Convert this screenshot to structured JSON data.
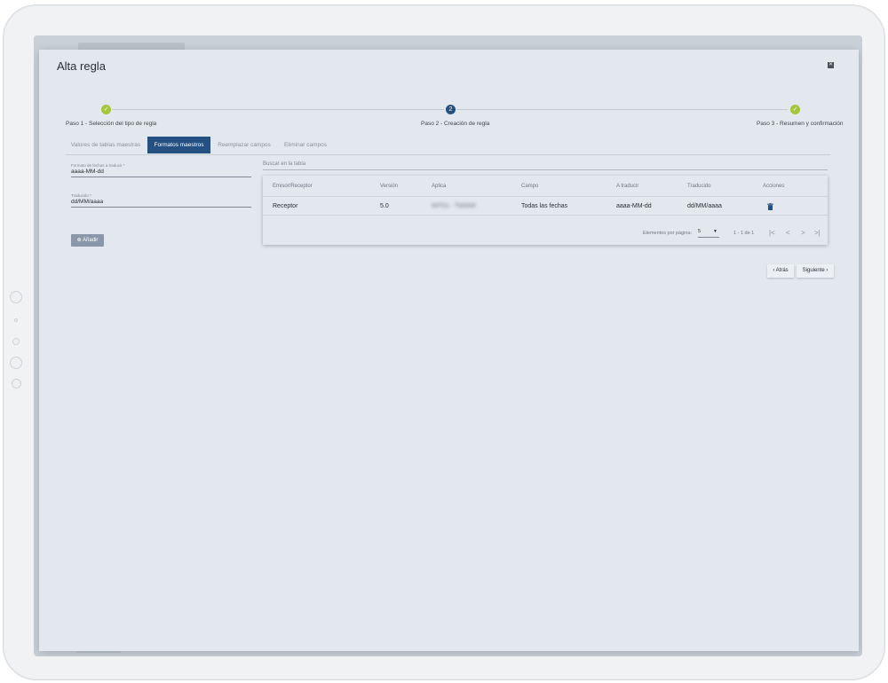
{
  "dialog": {
    "title": "Alta regla"
  },
  "stepper": {
    "steps": [
      {
        "label": "Paso 1 - Selección del tipo de regla",
        "state": "done"
      },
      {
        "label": "Paso 2 - Creación de regla",
        "state": "current",
        "number": "2"
      },
      {
        "label": "Paso 3 - Resumen y confirmación",
        "state": "done"
      }
    ],
    "done_color": "#a4c639",
    "current_color": "#245082"
  },
  "tabs": [
    {
      "label": "Valores de tablas maestras",
      "active": false
    },
    {
      "label": "Formatos maestros",
      "active": true
    },
    {
      "label": "Reemplazar campos",
      "active": false
    },
    {
      "label": "Eliminar campos",
      "active": false
    }
  ],
  "form": {
    "format_field": {
      "label": "Formato de fechas a traducir *",
      "value": "aaaa-MM-dd"
    },
    "translation_field": {
      "label": "Traducido *",
      "value": "dd/MM/aaaa"
    },
    "add_button": "Añadir"
  },
  "search": {
    "placeholder": "Buscar en la tabla"
  },
  "table": {
    "headers": [
      "Emisor/Receptor",
      "Versión",
      "Aplica",
      "Campo",
      "A traducir",
      "Traducido",
      "Acciones"
    ],
    "rows": [
      {
        "emisor": "Receptor",
        "version": "5.0",
        "aplica": "00T01 - T00000",
        "campo": "Todas las fechas",
        "a_traducir": "aaaa-MM-dd",
        "traducido": "dd/MM/aaaa"
      }
    ],
    "paginator": {
      "items_label": "Elementos por página:",
      "page_size": "5",
      "range": "1 - 1 de 1"
    }
  },
  "nav": {
    "back": "Atrás",
    "next": "Siguiente"
  },
  "accent_color": "#245082"
}
